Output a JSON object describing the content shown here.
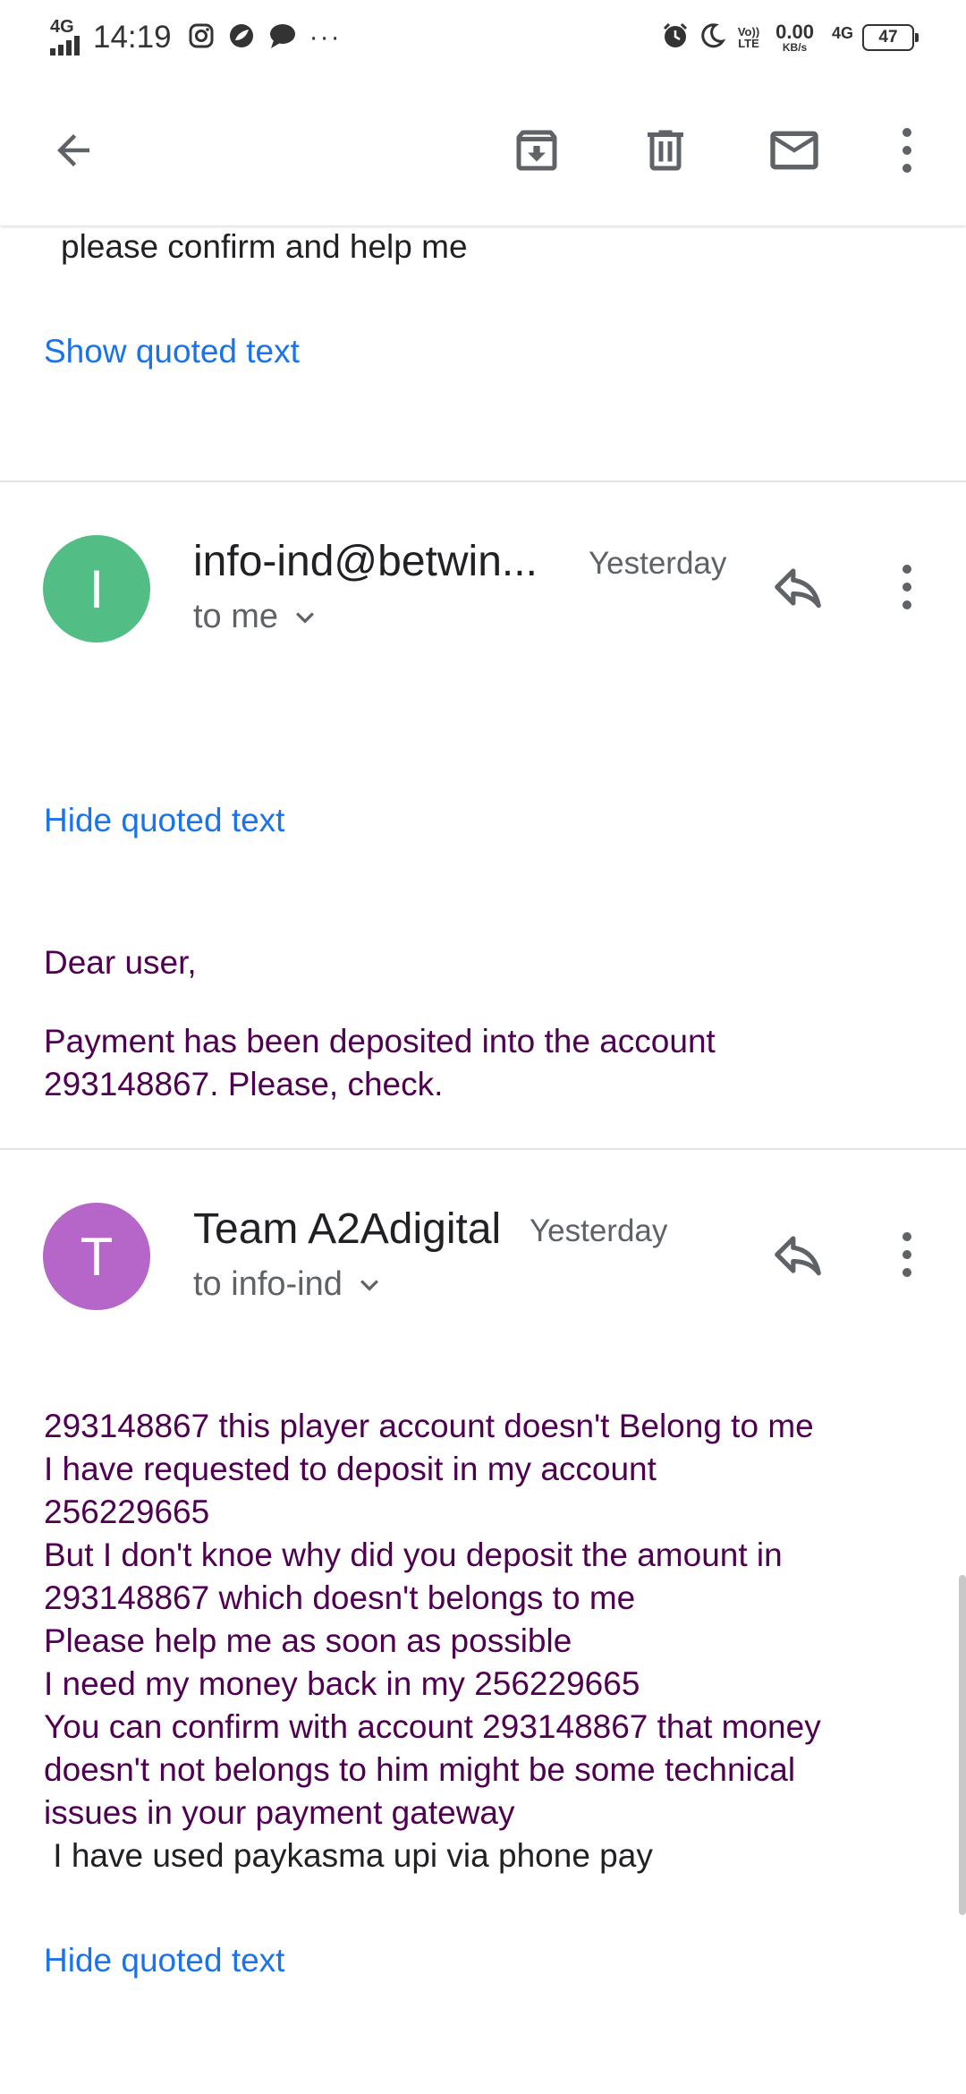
{
  "status_bar": {
    "signal_label": "4G",
    "time": "14:19",
    "more_indicator": "···",
    "volte_top": "Vo))",
    "volte_bottom": "LTE",
    "speed_value": "0.00",
    "speed_unit": "KB/s",
    "network_type": "4G",
    "battery_level": "47"
  },
  "toolbar": {
    "icons": [
      "back-arrow-icon",
      "archive-icon",
      "delete-icon",
      "mark-unread-icon",
      "more-vert-icon"
    ]
  },
  "top_fragment": {
    "last_line": "please confirm and help me",
    "show_quoted_label": "Show quoted text"
  },
  "messages": [
    {
      "avatar_letter": "I",
      "avatar_color": "#52bd84",
      "sender": "info-ind@betwin...",
      "date": "Yesterday",
      "recipient": "to me",
      "quoted_toggle": "Hide quoted text",
      "body": [
        "Dear user,",
        "Payment has been deposited into the account",
        "293148867. Please, check."
      ]
    },
    {
      "avatar_letter": "T",
      "avatar_color": "#b665c8",
      "sender": "Team A2Adigital",
      "date": "Yesterday",
      "recipient": "to info-ind",
      "quoted_toggle": "Hide quoted text",
      "body": [
        "293148867 this player account doesn't Belong to me",
        "I have requested to deposit in my account",
        "256229665",
        "But I don't knoe why did you deposit the amount in",
        "293148867 which doesn't belongs to me",
        "Please help me as soon as possible",
        "I need my money back in my 256229665",
        "You can confirm with account 293148867 that money",
        "doesn't not belongs to him might be some technical",
        "issues in your payment gateway",
        " I have used paykasma upi via phone pay"
      ]
    }
  ]
}
